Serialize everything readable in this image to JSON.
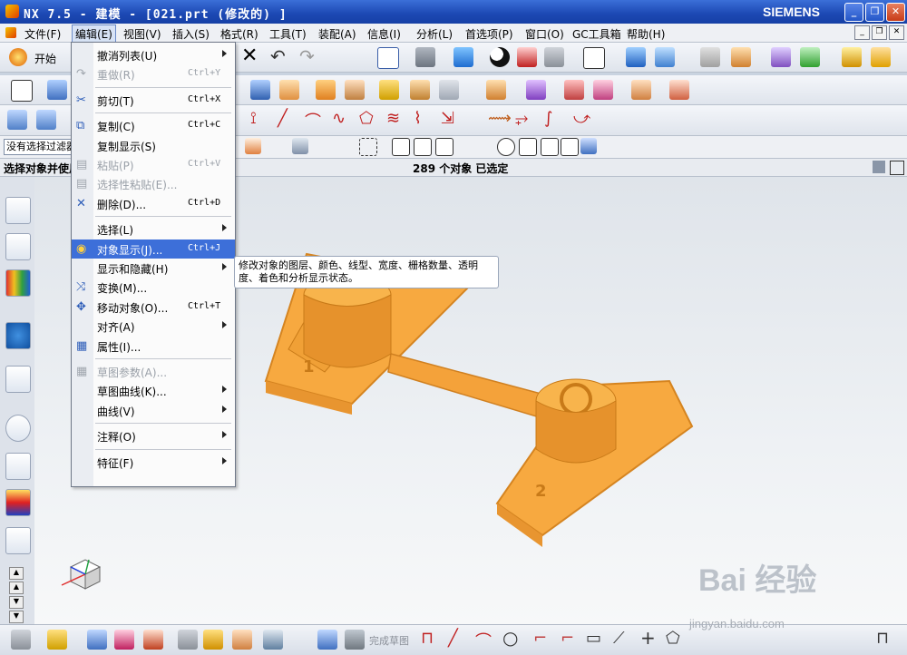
{
  "window": {
    "title": "NX 7.5 - 建模 - [021.prt (修改的) ]",
    "brand": "SIEMENS",
    "controls": [
      "_",
      "❐",
      "✕"
    ]
  },
  "menubar": {
    "items": [
      {
        "label": "文件(F)",
        "active": false
      },
      {
        "label": "编辑(E)",
        "active": true
      },
      {
        "label": "视图(V)",
        "active": false
      },
      {
        "label": "插入(S)",
        "active": false
      },
      {
        "label": "格式(R)",
        "active": false
      },
      {
        "label": "工具(T)",
        "active": false
      },
      {
        "label": "装配(A)",
        "active": false
      },
      {
        "label": "信息(I)",
        "active": false
      },
      {
        "label": "分析(L)",
        "active": false
      },
      {
        "label": "首选项(P)",
        "active": false
      },
      {
        "label": "窗口(O)",
        "active": false
      },
      {
        "label": "GC工具箱",
        "active": false
      },
      {
        "label": "帮助(H)",
        "active": false
      }
    ]
  },
  "toolbar": {
    "start_label": "开始",
    "finish_sketch_label": "完成草图"
  },
  "selection": {
    "filter_value": "没有选择过滤器"
  },
  "status": {
    "left": "选择对象并使用",
    "center": "289 个对象 已选定"
  },
  "edit_menu": {
    "items": [
      {
        "label": "撤消列表(U)",
        "shortcut": "",
        "submenu": true,
        "disabled": false,
        "icon": ""
      },
      {
        "label": "重做(R)",
        "shortcut": "Ctrl+Y",
        "submenu": false,
        "disabled": true,
        "icon": "redo-icon"
      },
      {
        "sep": true
      },
      {
        "label": "剪切(T)",
        "shortcut": "Ctrl+X",
        "submenu": false,
        "disabled": false,
        "icon": "cut-icon"
      },
      {
        "sep": true
      },
      {
        "label": "复制(C)",
        "shortcut": "Ctrl+C",
        "submenu": false,
        "disabled": false,
        "icon": "copy-icon"
      },
      {
        "label": "复制显示(S)",
        "shortcut": "",
        "submenu": false,
        "disabled": false,
        "icon": ""
      },
      {
        "label": "粘贴(P)",
        "shortcut": "Ctrl+V",
        "submenu": false,
        "disabled": true,
        "icon": "paste-icon"
      },
      {
        "label": "选择性粘贴(E)...",
        "shortcut": "",
        "submenu": false,
        "disabled": true,
        "icon": "paste-special-icon"
      },
      {
        "label": "删除(D)...",
        "shortcut": "Ctrl+D",
        "submenu": false,
        "disabled": false,
        "icon": "delete-icon"
      },
      {
        "sep": true
      },
      {
        "label": "选择(L)",
        "shortcut": "",
        "submenu": true,
        "disabled": false,
        "icon": ""
      },
      {
        "label": "对象显示(J)...",
        "shortcut": "Ctrl+J",
        "submenu": false,
        "disabled": false,
        "icon": "object-display-icon",
        "highlight": true
      },
      {
        "label": "显示和隐藏(H)",
        "shortcut": "",
        "submenu": true,
        "disabled": false,
        "icon": ""
      },
      {
        "label": "变换(M)...",
        "shortcut": "",
        "submenu": false,
        "disabled": false,
        "icon": "transform-icon"
      },
      {
        "label": "移动对象(O)...",
        "shortcut": "Ctrl+T",
        "submenu": false,
        "disabled": false,
        "icon": "move-object-icon"
      },
      {
        "label": "对齐(A)",
        "shortcut": "",
        "submenu": true,
        "disabled": false,
        "icon": ""
      },
      {
        "label": "属性(I)...",
        "shortcut": "",
        "submenu": false,
        "disabled": false,
        "icon": "properties-icon"
      },
      {
        "sep": true
      },
      {
        "label": "草图参数(A)...",
        "shortcut": "",
        "submenu": false,
        "disabled": true,
        "icon": "sketch-params-icon"
      },
      {
        "label": "草图曲线(K)...",
        "shortcut": "",
        "submenu": true,
        "disabled": false,
        "icon": ""
      },
      {
        "label": "曲线(V)",
        "shortcut": "",
        "submenu": true,
        "disabled": false,
        "icon": ""
      },
      {
        "sep": true
      },
      {
        "label": "注释(O)",
        "shortcut": "",
        "submenu": true,
        "disabled": false,
        "icon": ""
      },
      {
        "sep": true
      },
      {
        "label": "特征(F)",
        "shortcut": "",
        "submenu": true,
        "disabled": false,
        "icon": ""
      }
    ]
  },
  "tooltip": {
    "line1": "修改对象的图层、颜色、线型、宽度、栅格数量、透明",
    "line2": "度、着色和分析显示状态。"
  },
  "model": {
    "label_1": "1",
    "label_2": "2",
    "color": "#f5a53a"
  },
  "watermark": {
    "main": "Bai 经验",
    "sub": "jingyan.baidu.com"
  }
}
